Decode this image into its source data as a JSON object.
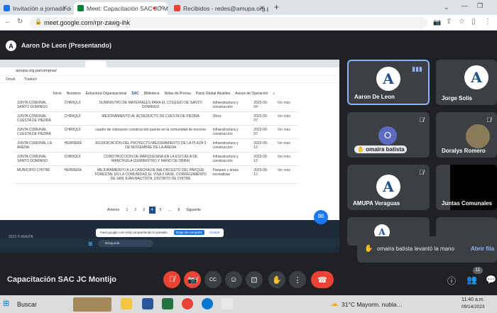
{
  "browser": {
    "tabs": [
      {
        "label": "Invitación a jornada de AMUPA"
      },
      {
        "label": "Meet: Capacitación SAC JC Mo"
      },
      {
        "label": "Recibidos - redes@amupa.org.pa"
      }
    ],
    "new_tab": "+",
    "url": "meet.google.com/rpr-zawg-ihk"
  },
  "meet": {
    "presenter_initial": "A",
    "presenter_label": "Aaron De Leon (Presentando)",
    "shared_screen": {
      "url": "amupa.org.pa/compras/",
      "bookmarks": [
        "Gmail",
        "Traducir"
      ],
      "nav": [
        "Inicio",
        "Nosotros",
        "Estructura Organizacional",
        "SAC",
        "Biblioteca",
        "Notas de Prensa",
        "Pacto Global Alcaldes",
        "Avisos de Operación"
      ],
      "rows": [
        {
          "entity": "JUNTA COMUNAL SANTO DOMINGO",
          "province": "CHIRIQUÍ",
          "desc": "SUMINISTRO DE MATERIALES PARA EL COLEGIO DE SANTO DOMINGO",
          "cat": "Infraestructura y construcción",
          "date": "2023-09-04",
          "btn": "Ver más"
        },
        {
          "entity": "JUNTA COMUNAL CUESTA DE PIEDRA",
          "province": "CHIRIQUÍ",
          "desc": "MEJORAMIENTO AL ACUEDUCTO DE CUESTA DE PIEDRA",
          "cat": "Otros",
          "date": "2023-09-07",
          "btn": "Ver más"
        },
        {
          "entity": "JUNTA COMUNAL CUESTA DE PIEDRA",
          "province": "CHIRIQUÍ",
          "desc": "cuadro de cotizacion construcción puente en la comunidad de escoreo",
          "cat": "Infraestructura y construcción",
          "date": "2023-09-07",
          "btn": "Ver más"
        },
        {
          "entity": "JUNTA COMUNAL LA ARENA",
          "province": "HERRERA",
          "desc": "ADJUDICACIÓN DEL PROYECTO MEJORAMIENTO DE LA PLAZA 3 DE NOVIEMBRE DE LA ARENA",
          "cat": "Infraestructura y construcción",
          "date": "2023-09-12",
          "btn": "Ver más"
        },
        {
          "entity": "JUNTA COMUNAL SANTO DOMINGO",
          "province": "CHIRIQUÍ",
          "desc": "CONSTRUCCION DE MARQUESINA EN LA ESCUELA DE MANCHUILA (SUMINISTRO Y MANO DE OBRA)",
          "cat": "Infraestructura y construcción",
          "date": "2023-09-12",
          "btn": "Ver más"
        },
        {
          "entity": "MUNICIPIO CHITRÉ",
          "province": "HERRERA",
          "desc": "MEJORAMIENTO A LA CANCHA DE BALONCESTO DEL PARQUE FORESTAL EN LA COMUNIDAD EL VISA II FASE, CORREGIMIENTO DE SAN JUAN BAUTISTA, DISTRITO DE CHITRÉ",
          "cat": "Parques y áreas recreativas",
          "date": "2023-09-12",
          "btn": "Ver más"
        }
      ],
      "pagination": [
        "Anterior",
        "1",
        "2",
        "3",
        "4",
        "5",
        "…",
        "8",
        "Siguiente"
      ],
      "footer": "2023 © AMUPA",
      "share_notice": "meet.google.com está compartiendo tu pantalla.",
      "stop_share": "Dejar de compartir",
      "hide": "Ocultar",
      "search_placeholder": "Búsqueda"
    },
    "participants": [
      {
        "name": "Aaron De Leon"
      },
      {
        "name": "Jorge Solís"
      },
      {
        "name": "omaira batista",
        "initial": "O"
      },
      {
        "name": "Doralys Romero"
      },
      {
        "name": "AMUPA Veraguas"
      },
      {
        "name": "Juntas Comunales"
      }
    ],
    "hand_notice": "omaira batista levantó la mano",
    "view_queue": "Abrir fila",
    "meeting_title": "Capacitación SAC JC Montijo",
    "people_count": "11"
  },
  "taskbar": {
    "search": "Buscar",
    "weather": "31°C  Mayorm. nubla…",
    "time": "11:40 a.m.",
    "date": "09/14/2023"
  }
}
